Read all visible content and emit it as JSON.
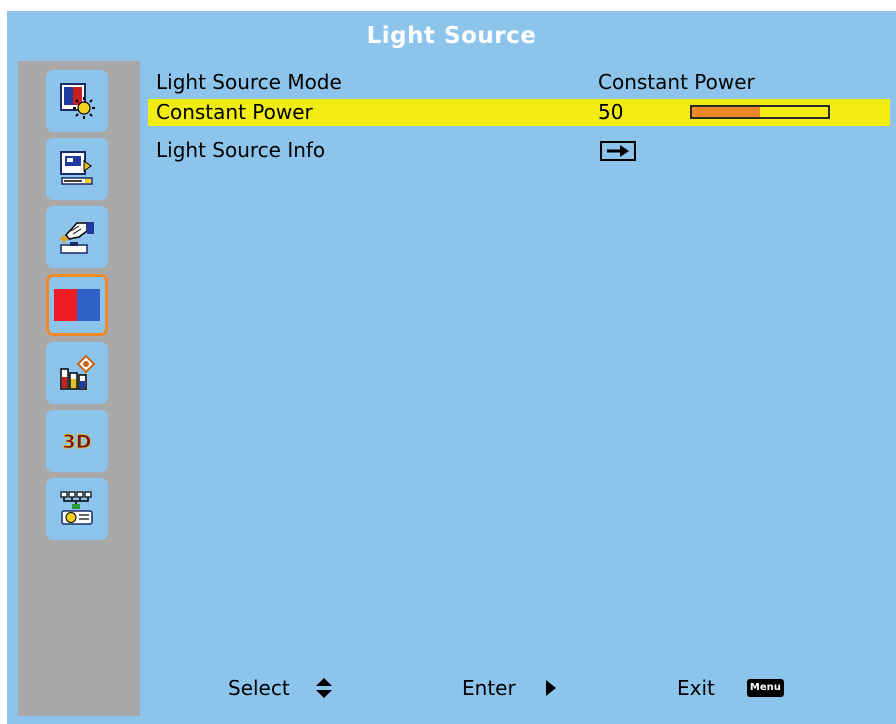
{
  "header": {
    "title": "Light Source"
  },
  "sidebar": {
    "items": [
      {
        "icon": "picture-settings-icon",
        "selected": false
      },
      {
        "icon": "display-settings-icon",
        "selected": false
      },
      {
        "icon": "setup-icon",
        "selected": false
      },
      {
        "icon": "color-options-icon",
        "selected": true
      },
      {
        "icon": "information-icon",
        "selected": false
      },
      {
        "icon": "3d-icon",
        "label": "3D",
        "selected": false
      },
      {
        "icon": "network-icon",
        "selected": false
      }
    ]
  },
  "menu": {
    "rows": [
      {
        "label": "Light Source Mode",
        "value": "Constant Power"
      },
      {
        "label": "Constant Power",
        "value": "50",
        "level_percent": 50,
        "highlighted": true
      },
      {
        "label": "Light Source Info",
        "control": "enter-arrow-icon"
      }
    ]
  },
  "footer": {
    "select_label": "Select",
    "enter_label": "Enter",
    "exit_label": "Exit",
    "menu_key_label": "Menu"
  },
  "colors": {
    "background": "#8cc4ec",
    "sidebar": "#a9a9a9",
    "highlight": "#f1ec12",
    "accent": "#f08a24",
    "title_text": "#ffffff"
  }
}
